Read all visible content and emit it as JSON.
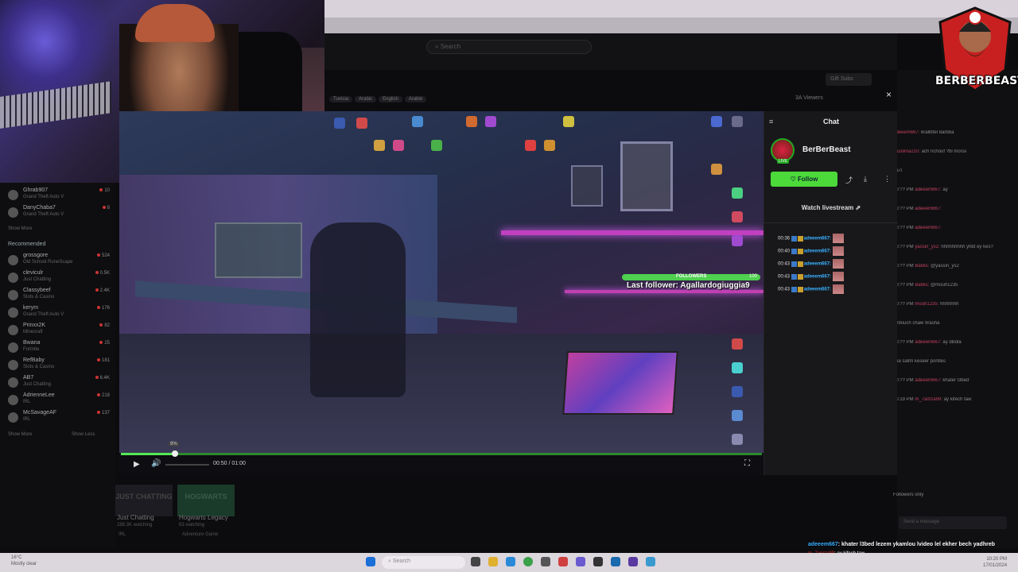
{
  "search": {
    "placeholder": "Search"
  },
  "header": {
    "gift_subs": "Gift Subs",
    "viewers": "3A Viewers",
    "tags": [
      "Tunisia",
      "Arabic",
      "English",
      "Arabie"
    ]
  },
  "sidebar": {
    "items_top": [
      {
        "name": "Ghrab907",
        "game": "Grand Theft Auto V",
        "count": "10"
      },
      {
        "name": "DanyChaba7",
        "game": "Grand Theft Auto V",
        "count": "8"
      }
    ],
    "show_more_top": "Show More",
    "recommended_label": "Recommended",
    "recommended": [
      {
        "name": "grossgore",
        "game": "Old School RuneScape",
        "count": "524"
      },
      {
        "name": "cleviculr",
        "game": "Just Chatting",
        "count": "0.5K"
      },
      {
        "name": "Classybeef",
        "game": "Slots & Casino",
        "count": "2.4K"
      },
      {
        "name": "kerym",
        "game": "Grand Theft Auto V",
        "count": "176"
      },
      {
        "name": "Prinxx2K",
        "game": "Minecraft",
        "count": "82"
      },
      {
        "name": "Bwana",
        "game": "Fortnite",
        "count": "25"
      },
      {
        "name": "RefBaby",
        "game": "Slots & Casino",
        "count": "181"
      },
      {
        "name": "AB7",
        "game": "Just Chatting",
        "count": "6.4K"
      },
      {
        "name": "AdrienneLee",
        "game": "IRL",
        "count": "218"
      },
      {
        "name": "McSavageAF",
        "game": "IRL",
        "count": "137"
      }
    ],
    "show_more": "Show More",
    "show_less": "Show Less"
  },
  "bottom_cards": [
    {
      "art": "JUST CHATTING",
      "title": "Just Chatting",
      "sub": "288.3K watching",
      "tag": "IRL"
    },
    {
      "art": "HOGWARTS",
      "title": "Hogwarts Legacy",
      "sub": "63 watching",
      "tag": "Adventure Game"
    }
  ],
  "logo": {
    "text": "BERBERBEAST"
  },
  "popup": {
    "menu_icon": "≡",
    "title": "Chat",
    "channel_name": "BerBerBeast",
    "live_badge": "LIVE",
    "follow_label": "♡ Follow",
    "watch_label": "Watch livestream ⇗",
    "messages": [
      {
        "time": "00:36",
        "user": "adeeem667:"
      },
      {
        "time": "00:40",
        "user": "adeeem667:"
      },
      {
        "time": "00:43",
        "user": "adeeem667:"
      },
      {
        "time": "00:43",
        "user": "adeeem667:"
      },
      {
        "time": "00:43",
        "user": "adeeem667:"
      }
    ]
  },
  "video": {
    "followers_label": "FOLLOWERS",
    "followers_count": "100",
    "last_follower": "Last follower: Agallardogiuggia9",
    "time": "00:50 / 01:00",
    "progress_tip": "9%",
    "progress": 0.09
  },
  "overlay_chat": [
    {
      "user": "adeeem667",
      "text": ": khater l3bed lezem ykamlou lvideo lel ekher bech yadhreb"
    },
    {
      "user": "m_7amza99",
      "text": ": ay kifech taw"
    }
  ],
  "right_chat": [
    {
      "time": "",
      "user": "adeeem667:",
      "text": "6rallbfel 8arbba"
    },
    {
      "time": "",
      "user": "muslima210:",
      "text": "ach nchouf ?bl mossi"
    },
    {
      "time": "",
      "user": "",
      "text": "ba7i"
    },
    {
      "time": "10:?? PM",
      "user": "adeeem667:",
      "text": "ay"
    },
    {
      "time": "10:?? PM",
      "user": "adeeem667:",
      "text": ""
    },
    {
      "time": "10:?? PM",
      "user": "adeeem667:",
      "text": ""
    },
    {
      "time": "10:?? PM",
      "user": "yassin_ys2:",
      "text": "hhhhhhhhh yhbt ey kes?"
    },
    {
      "time": "10:?? PM",
      "user": "Batiks:",
      "text": "@yassin_ys2"
    },
    {
      "time": "10:?? PM",
      "user": "Batiks:",
      "text": "@mouh1235"
    },
    {
      "time": "10:?? PM",
      "user": "mouh1235:",
      "text": "hhhhhhh"
    },
    {
      "time": "",
      "user": "",
      "text": "ye9ouch chaw 9rasha"
    },
    {
      "time": "10:?? PM",
      "user": "adeeem667:",
      "text": "ay dBdla"
    },
    {
      "time": "",
      "user": "",
      "text": "cha sallm keseer pontles"
    },
    {
      "time": "10:?? PM",
      "user": "adeeem667:",
      "text": "khater l3bed"
    },
    {
      "time": "10:19 PM",
      "user": "m_7amza99:",
      "text": "ay kifech taw"
    }
  ],
  "right_chat_input": {
    "placeholder": "Send a message"
  },
  "right_chat_followers": "Followers only",
  "taskbar": {
    "weather_temp": "16°C",
    "weather_desc": "Mostly clear",
    "search_label": "Search",
    "clock_time": "10:20 PM",
    "clock_date": "17/01/2024"
  },
  "colors": {
    "accent_green": "#4cd93a",
    "chat_user": "#3ab0ff",
    "follower_bar": "#4fd04f"
  }
}
